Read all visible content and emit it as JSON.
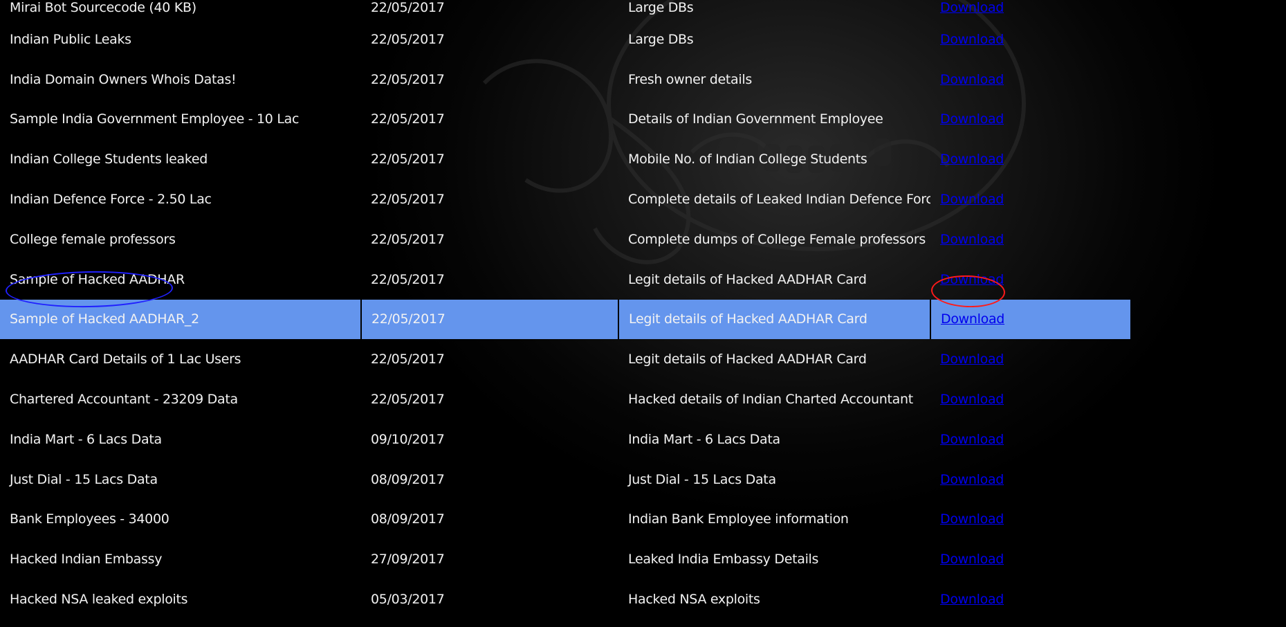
{
  "rows": [
    {
      "name": "Mirai Bot Sourcecode (40 KB)",
      "date": "22/05/2017",
      "desc": "Large DBs",
      "link": "Download"
    },
    {
      "name": "Indian Public Leaks",
      "date": "22/05/2017",
      "desc": "Large DBs",
      "link": "Download"
    },
    {
      "name": "India Domain Owners Whois Datas!",
      "date": "22/05/2017",
      "desc": "Fresh owner details",
      "link": "Download"
    },
    {
      "name": "Sample India Government Employee - 10 Lac",
      "date": "22/05/2017",
      "desc": "Details of Indian Government Employee",
      "link": "Download"
    },
    {
      "name": "Indian College Students leaked",
      "date": "22/05/2017",
      "desc": "Mobile No. of Indian College Students",
      "link": "Download"
    },
    {
      "name": "Indian Defence Force - 2.50 Lac",
      "date": "22/05/2017",
      "desc": "Complete details of Leaked Indian Defence Force",
      "link": "Download"
    },
    {
      "name": "College female professors",
      "date": "22/05/2017",
      "desc": "Complete dumps of College Female professors",
      "link": "Download"
    },
    {
      "name": "Sample of Hacked AADHAR",
      "date": "22/05/2017",
      "desc": "Legit details of Hacked AADHAR Card",
      "link": "Download"
    },
    {
      "name": "Sample of Hacked AADHAR_2",
      "date": "22/05/2017",
      "desc": "Legit details of Hacked AADHAR Card",
      "link": "Download"
    },
    {
      "name": "AADHAR Card Details of 1 Lac Users",
      "date": "22/05/2017",
      "desc": "Legit details of Hacked AADHAR Card",
      "link": "Download"
    },
    {
      "name": "Chartered Accountant - 23209 Data",
      "date": "22/05/2017",
      "desc": "Hacked details of Indian Charted Accountant",
      "link": "Download"
    },
    {
      "name": "India Mart - 6 Lacs Data",
      "date": "09/10/2017",
      "desc": "India Mart - 6 Lacs Data",
      "link": "Download"
    },
    {
      "name": "Just Dial - 15 Lacs Data",
      "date": "08/09/2017",
      "desc": "Just Dial - 15 Lacs Data",
      "link": "Download"
    },
    {
      "name": "Bank Employees - 34000",
      "date": "08/09/2017",
      "desc": "Indian Bank Employee information",
      "link": "Download"
    },
    {
      "name": "Hacked Indian Embassy",
      "date": "27/09/2017",
      "desc": "Leaked India Embassy Details",
      "link": "Download"
    },
    {
      "name": "Hacked NSA leaked exploits",
      "date": "05/03/2017",
      "desc": "Hacked NSA exploits",
      "link": "Download"
    }
  ],
  "highlighted_row": 8,
  "annotations": {
    "blue_circle_color": "#2020ff",
    "red_circle_color": "#ff1a1a"
  },
  "colors": {
    "background": "#000000",
    "row_highlight": "#6495ed",
    "text": "#f2f2f2",
    "link": "#0000ee"
  }
}
